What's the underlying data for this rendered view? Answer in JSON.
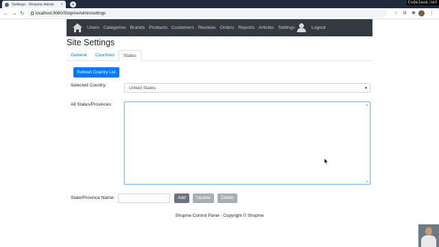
{
  "browser": {
    "tab_title": "Settings - Shopme Admin",
    "tab_close": "×",
    "new_tab": "+",
    "url": "localhost:8080/ShopmeAdmin/settings",
    "watermark": "CodeJava.net"
  },
  "navbar": {
    "links": [
      "Users",
      "Categories",
      "Brands",
      "Products",
      "Customers",
      "Reviews",
      "Orders",
      "Reports",
      "Articles",
      "Settings"
    ],
    "logout": "Logout"
  },
  "page": {
    "title": "Site Settings",
    "tabs": [
      {
        "label": "General",
        "active": false
      },
      {
        "label": "Countries",
        "active": false
      },
      {
        "label": "States",
        "active": true
      }
    ],
    "refresh_button": "Refresh Country List",
    "selected_country_label": "Selected Country:",
    "selected_country_value": "United States",
    "states_label": "All States/Provinces:",
    "name_label": "State/Province Name:",
    "name_value": "",
    "add_button": "Add",
    "update_button": "Update",
    "delete_button": "Delete",
    "footer": "Shopme Control Panel - Copyright © Shopme"
  },
  "colors": {
    "navbar_bg": "#343a40",
    "primary": "#007bff",
    "secondary": "#6c757d"
  }
}
